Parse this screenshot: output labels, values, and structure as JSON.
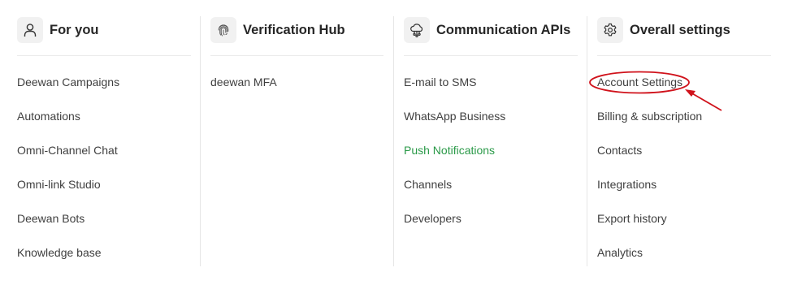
{
  "colors": {
    "accent_green": "#2b9a49",
    "annotation_red": "#d0121b",
    "text": "#3f3f3f",
    "heading": "#262626"
  },
  "columns": [
    {
      "title": "For you",
      "icon": "user-icon",
      "items": [
        {
          "label": "Deewan Campaigns"
        },
        {
          "label": "Automations"
        },
        {
          "label": "Omni-Channel Chat"
        },
        {
          "label": "Omni-link Studio"
        },
        {
          "label": "Deewan Bots"
        },
        {
          "label": "Knowledge base"
        }
      ]
    },
    {
      "title": "Verification Hub",
      "icon": "fingerprint-icon",
      "items": [
        {
          "label": "deewan MFA"
        }
      ]
    },
    {
      "title": "Communication APIs",
      "icon": "cloud-network-icon",
      "items": [
        {
          "label": "E-mail to SMS"
        },
        {
          "label": "WhatsApp Business"
        },
        {
          "label": "Push Notifications",
          "active": true
        },
        {
          "label": "Channels"
        },
        {
          "label": "Developers"
        }
      ]
    },
    {
      "title": "Overall settings",
      "icon": "gear-icon",
      "items": [
        {
          "label": "Account Settings",
          "highlighted": true
        },
        {
          "label": "Billing & subscription"
        },
        {
          "label": "Contacts"
        },
        {
          "label": "Integrations"
        },
        {
          "label": "Export history"
        },
        {
          "label": "Analytics"
        }
      ]
    }
  ]
}
